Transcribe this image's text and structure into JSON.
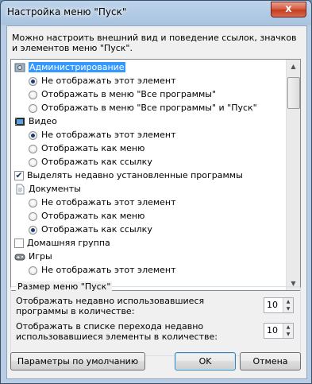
{
  "window": {
    "title": "Настройка меню \"Пуск\"",
    "close_glyph": "x"
  },
  "description": "Можно настроить внешний вид и поведение ссылок, значков и элементов меню \"Пуск\".",
  "list": {
    "items": [
      {
        "kind": "header",
        "label": "Администрирование",
        "icon": "admin-tools-icon",
        "selected": true
      },
      {
        "kind": "radio",
        "label": "Не отображать этот элемент",
        "checked": true
      },
      {
        "kind": "radio",
        "label": "Отображать в меню \"Все программы\"",
        "checked": false
      },
      {
        "kind": "radio",
        "label": "Отображать в меню \"Все программы\" и \"Пуск\"",
        "checked": false
      },
      {
        "kind": "header",
        "label": "Видео",
        "icon": "video-icon"
      },
      {
        "kind": "radio",
        "label": "Не отображать этот элемент",
        "checked": true
      },
      {
        "kind": "radio",
        "label": "Отображать как меню",
        "checked": false
      },
      {
        "kind": "radio",
        "label": "Отображать как ссылку",
        "checked": false
      },
      {
        "kind": "check",
        "label": "Выделять недавно установленные программы",
        "checked": true
      },
      {
        "kind": "header",
        "label": "Документы",
        "icon": "documents-icon"
      },
      {
        "kind": "radio",
        "label": "Не отображать этот элемент",
        "checked": false
      },
      {
        "kind": "radio",
        "label": "Отображать как меню",
        "checked": false
      },
      {
        "kind": "radio",
        "label": "Отображать как ссылку",
        "checked": true
      },
      {
        "kind": "check",
        "label": "Домашняя группа",
        "checked": false
      },
      {
        "kind": "header",
        "label": "Игры",
        "icon": "games-icon"
      },
      {
        "kind": "radio",
        "label": "Не отображать этот элемент",
        "checked": false
      }
    ]
  },
  "size_group": {
    "label": "Размер меню \"Пуск\"",
    "recent_programs_label": "Отображать недавно использовавшиеся программы в количестве:",
    "recent_programs_value": "10",
    "jumplist_label": "Отображать в списке перехода недавно использовавшиеся элементы в количестве:",
    "jumplist_value": "10"
  },
  "buttons": {
    "defaults": "Параметры по умолчанию",
    "ok": "OK",
    "cancel": "Отмена"
  }
}
